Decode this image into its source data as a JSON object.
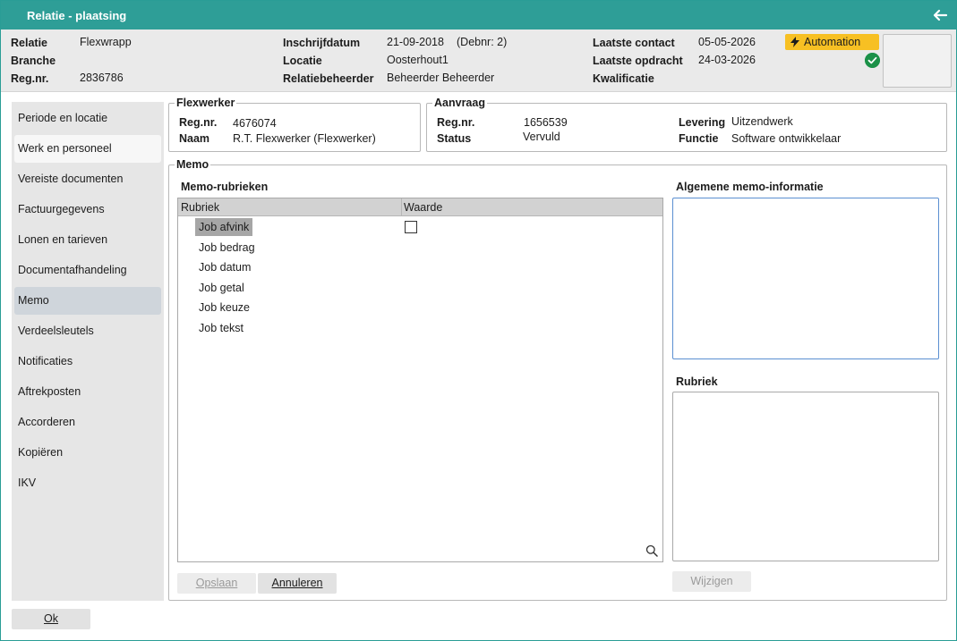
{
  "window": {
    "title": "Relatie - plaatsing"
  },
  "header": {
    "relatie_label": "Relatie",
    "relatie_value": "Flexwrapp",
    "branche_label": "Branche",
    "regnr_label": "Reg.nr.",
    "regnr_value": "2836786",
    "inschrijf_label": "Inschrijfdatum",
    "inschrijf_value": "21-09-2018",
    "debnr": "(Debnr: 2)",
    "locatie_label": "Locatie",
    "locatie_value": "Oosterhout1",
    "beheerder_label": "Relatiebeheerder",
    "beheerder_value": "Beheerder Beheerder",
    "contact_label": "Laatste contact",
    "contact_value": "05-05-2026",
    "opdracht_label": "Laatste opdracht",
    "opdracht_value": "24-03-2026",
    "kwalificatie_label": "Kwalificatie",
    "automation_label": "Automation",
    "automation_color": "#f7c023",
    "status_icon": "check-circle-icon"
  },
  "sidebar": {
    "items": [
      {
        "label": "Periode en locatie"
      },
      {
        "label": "Werk en personeel"
      },
      {
        "label": "Vereiste documenten"
      },
      {
        "label": "Factuurgegevens"
      },
      {
        "label": "Lonen en tarieven"
      },
      {
        "label": "Documentafhandeling"
      },
      {
        "label": "Memo"
      },
      {
        "label": "Verdeelsleutels"
      },
      {
        "label": "Notificaties"
      },
      {
        "label": "Aftrekposten"
      },
      {
        "label": "Accorderen"
      },
      {
        "label": "Kopiëren"
      },
      {
        "label": "IKV"
      }
    ],
    "active": "Memo"
  },
  "flexwerker": {
    "legend": "Flexwerker",
    "regnr_label": "Reg.nr.",
    "regnr_value": "4676074",
    "naam_label": "Naam",
    "naam_value": "R.T. Flexwerker (Flexwerker)"
  },
  "aanvraag": {
    "legend": "Aanvraag",
    "regnr_label": "Reg.nr.",
    "regnr_value": "1656539",
    "status_label": "Status",
    "status_value": "Vervuld",
    "levering_label": "Levering",
    "levering_value": "Uitzendwerk",
    "functie_label": "Functie",
    "functie_value": "Software ontwikkelaar"
  },
  "memo": {
    "legend": "Memo",
    "rubrieken_title": "Memo-rubrieken",
    "col_rubriek": "Rubriek",
    "col_waarde": "Waarde",
    "rows": [
      {
        "label": "Job afvink"
      },
      {
        "label": "Job bedrag"
      },
      {
        "label": "Job datum"
      },
      {
        "label": "Job getal"
      },
      {
        "label": "Job keuze"
      },
      {
        "label": "Job tekst"
      }
    ],
    "algemeen_title": "Algemene memo-informatie",
    "rubriek_title": "Rubriek",
    "opslaan": "Opslaan",
    "annuleren": "Annuleren",
    "wijzigen": "Wijzigen"
  },
  "footer": {
    "ok": "Ok"
  }
}
